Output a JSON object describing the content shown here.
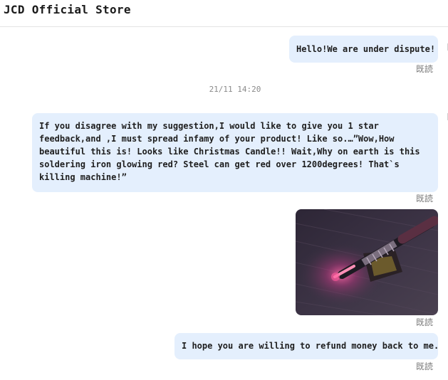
{
  "header": {
    "store_name": "JCD Official Store"
  },
  "messages": [
    {
      "text": "Hello!We are under dispute!",
      "read_status": "既読"
    },
    {
      "text": "If you disagree with my suggestion,I would like to give you 1 star feedback,and ,I must spread infamy of your product! Like so.…”Wow,How beautiful this is! Looks like Christmas Candle!! Wait,Why on earth is this soldering iron glowing red? Steel can get red over 1200degrees! That`s killing machine!”",
      "read_status": "既読"
    },
    {
      "image": "soldering-iron-photo",
      "read_status": "既読"
    },
    {
      "text": "I hope you are willing to refund money back to me.",
      "read_status": "既読"
    }
  ],
  "timestamp": "21/11 14:20",
  "colors": {
    "bubble": "#e4effd",
    "read_text": "#7a7a7a",
    "timestamp_text": "#8a8a8a"
  }
}
